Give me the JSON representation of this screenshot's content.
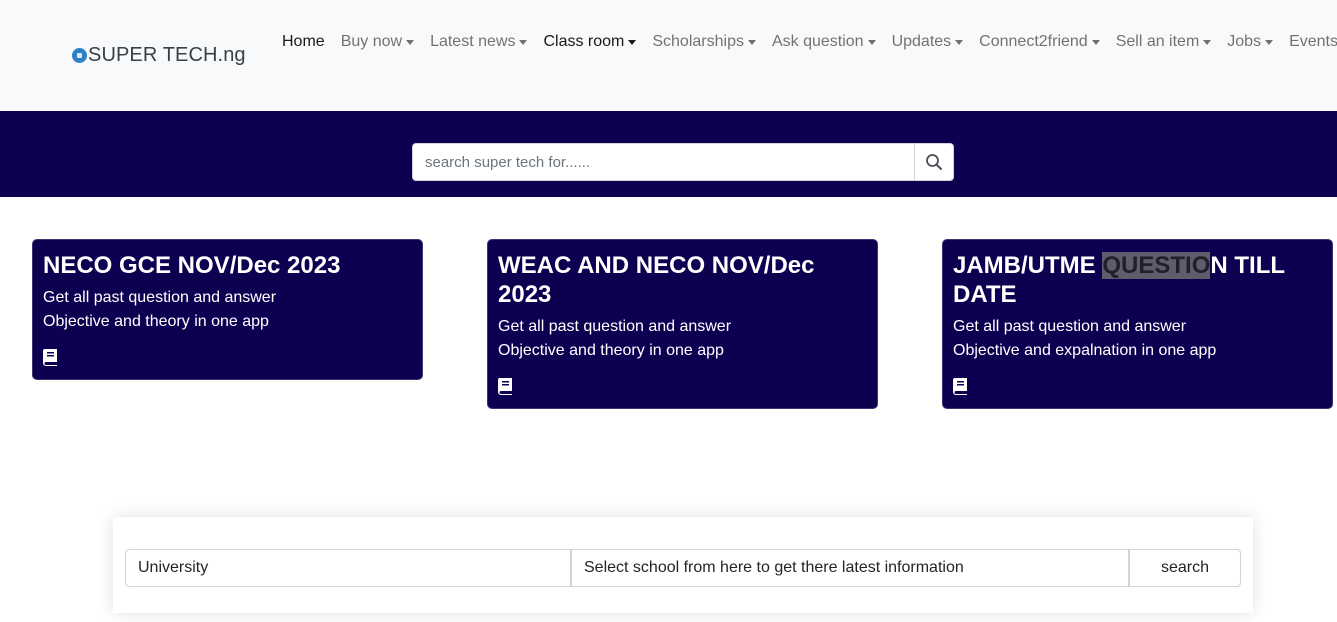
{
  "brand": {
    "name": "SUPER TECH.ng",
    "icon": "logo-dot-icon",
    "color": "#2f7fc1"
  },
  "nav": {
    "items": [
      {
        "label": "Home",
        "dropdown": false,
        "active": true
      },
      {
        "label": "Buy now",
        "dropdown": true,
        "active": false
      },
      {
        "label": "Latest news",
        "dropdown": true,
        "active": false
      },
      {
        "label": "Class room",
        "dropdown": true,
        "active": true
      },
      {
        "label": "Scholarships",
        "dropdown": true,
        "active": false
      },
      {
        "label": "Ask question",
        "dropdown": true,
        "active": false
      },
      {
        "label": "Updates",
        "dropdown": true,
        "active": false
      },
      {
        "label": "Connect2friend",
        "dropdown": true,
        "active": false
      },
      {
        "label": "Sell an item",
        "dropdown": true,
        "active": false
      },
      {
        "label": "Jobs",
        "dropdown": true,
        "active": false
      },
      {
        "label": "Events",
        "dropdown": true,
        "active": false
      }
    ]
  },
  "hero": {
    "background": "#0e0050",
    "search_placeholder": "search super tech for......",
    "search_icon": "search-icon"
  },
  "cards": [
    {
      "title": "NECO GCE NOV/Dec 2023",
      "line1": "Get all past question and answer",
      "line2": "Objective and theory in one app",
      "icon": "book-icon"
    },
    {
      "title": "WEAC AND NECO NOV/Dec 2023",
      "line1": "Get all past question and answer",
      "line2": "Objective and theory in one app",
      "icon": "book-icon"
    },
    {
      "title_part1": "JAMB/UTME ",
      "title_highlight": "QUESTIO",
      "title_part2": "N TILL DATE",
      "line1": "Get all past question and answer",
      "line2": "Objective and expalnation in one app",
      "icon": "book-icon"
    }
  ],
  "school_search": {
    "type_value": "University",
    "select_value": "Select school from here to get there latest information",
    "button_label": "search"
  }
}
